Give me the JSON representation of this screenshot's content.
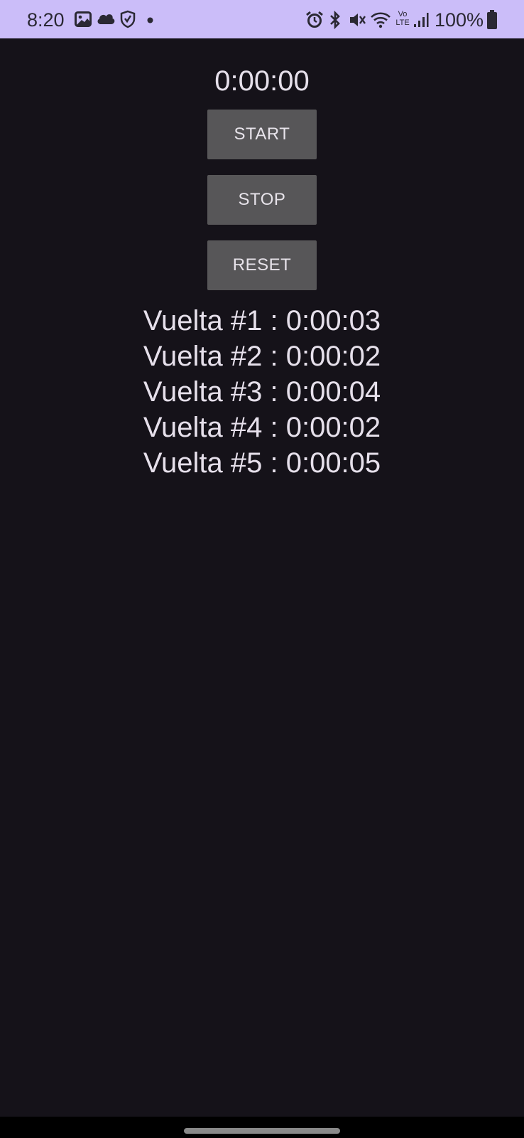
{
  "status_bar": {
    "time": "8:20",
    "battery_percent": "100%",
    "left_icons": [
      "gallery-icon",
      "cloud-icon",
      "shield-icon",
      "dot-icon"
    ],
    "right_icons": [
      "alarm-icon",
      "bluetooth-icon",
      "mute-icon",
      "wifi-icon",
      "volte-icon",
      "signal-icon",
      "battery-icon"
    ],
    "volte_label_top": "Vo",
    "volte_label_bottom": "LTE",
    "background_color": "#cbbdf9"
  },
  "stopwatch": {
    "display": "0:00:00",
    "start_label": "START",
    "stop_label": "STOP",
    "reset_label": "RESET",
    "button_color": "#575658",
    "background_color": "#151219"
  },
  "laps": [
    "Vuelta #1 : 0:00:03",
    "Vuelta #2 : 0:00:02",
    "Vuelta #3 : 0:00:04",
    "Vuelta #4 : 0:00:02",
    "Vuelta #5 : 0:00:05"
  ]
}
